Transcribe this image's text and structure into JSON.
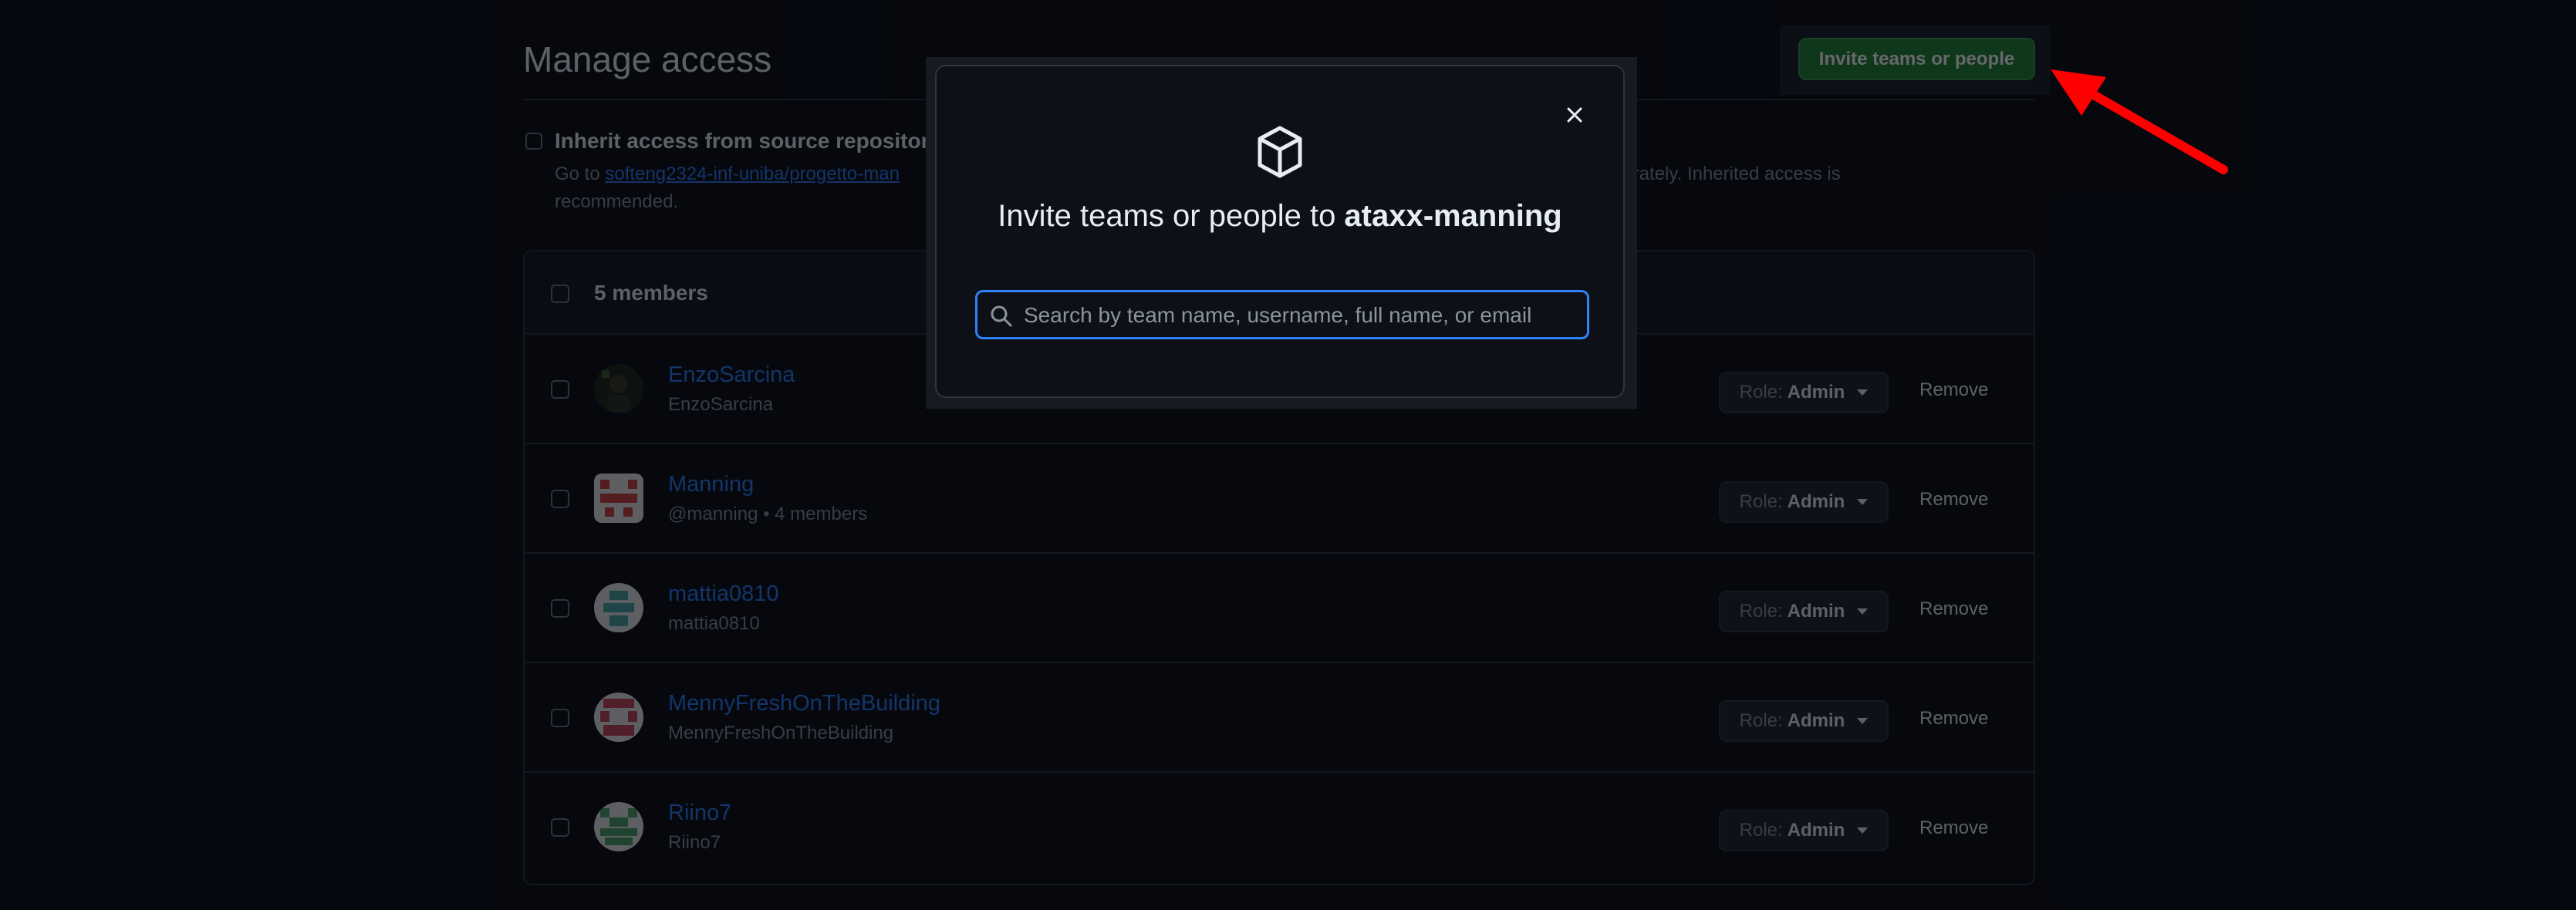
{
  "page": {
    "title": "Manage access",
    "invite_button_label": "Invite teams or people"
  },
  "inherit": {
    "label": "Inherit access from source repository",
    "desc_prefix": "Go to ",
    "desc_link": "softeng2324-inf-uniba/progetto-man",
    "desc_suffix": "e it separately. Inherited access is recommended."
  },
  "members": {
    "count_label": "5 members",
    "rows": [
      {
        "name": "EnzoSarcina",
        "sub": "EnzoSarcina",
        "role_prefix": "Role:",
        "role": "Admin",
        "remove": "Remove"
      },
      {
        "name": "Manning",
        "sub": "@manning • 4 members",
        "role_prefix": "Role:",
        "role": "Admin",
        "remove": "Remove"
      },
      {
        "name": "mattia0810",
        "sub": "mattia0810",
        "role_prefix": "Role:",
        "role": "Admin",
        "remove": "Remove"
      },
      {
        "name": "MennyFreshOnTheBuilding",
        "sub": "MennyFreshOnTheBuilding",
        "role_prefix": "Role:",
        "role": "Admin",
        "remove": "Remove"
      },
      {
        "name": "Riino7",
        "sub": "Riino7",
        "role_prefix": "Role:",
        "role": "Admin",
        "remove": "Remove"
      }
    ]
  },
  "modal": {
    "title_prefix": "Invite teams or people to ",
    "repo_name": "ataxx-manning",
    "search_placeholder": "Search by team name, username, full name, or email",
    "search_value": ""
  },
  "icons": {
    "repo": "package-icon",
    "close": "close-icon",
    "search": "search-icon",
    "annotation": "red-arrow-icon"
  },
  "colors": {
    "accent": "#2f81f7",
    "invite_button": "#238636",
    "annotation_arrow": "#ff0000"
  }
}
